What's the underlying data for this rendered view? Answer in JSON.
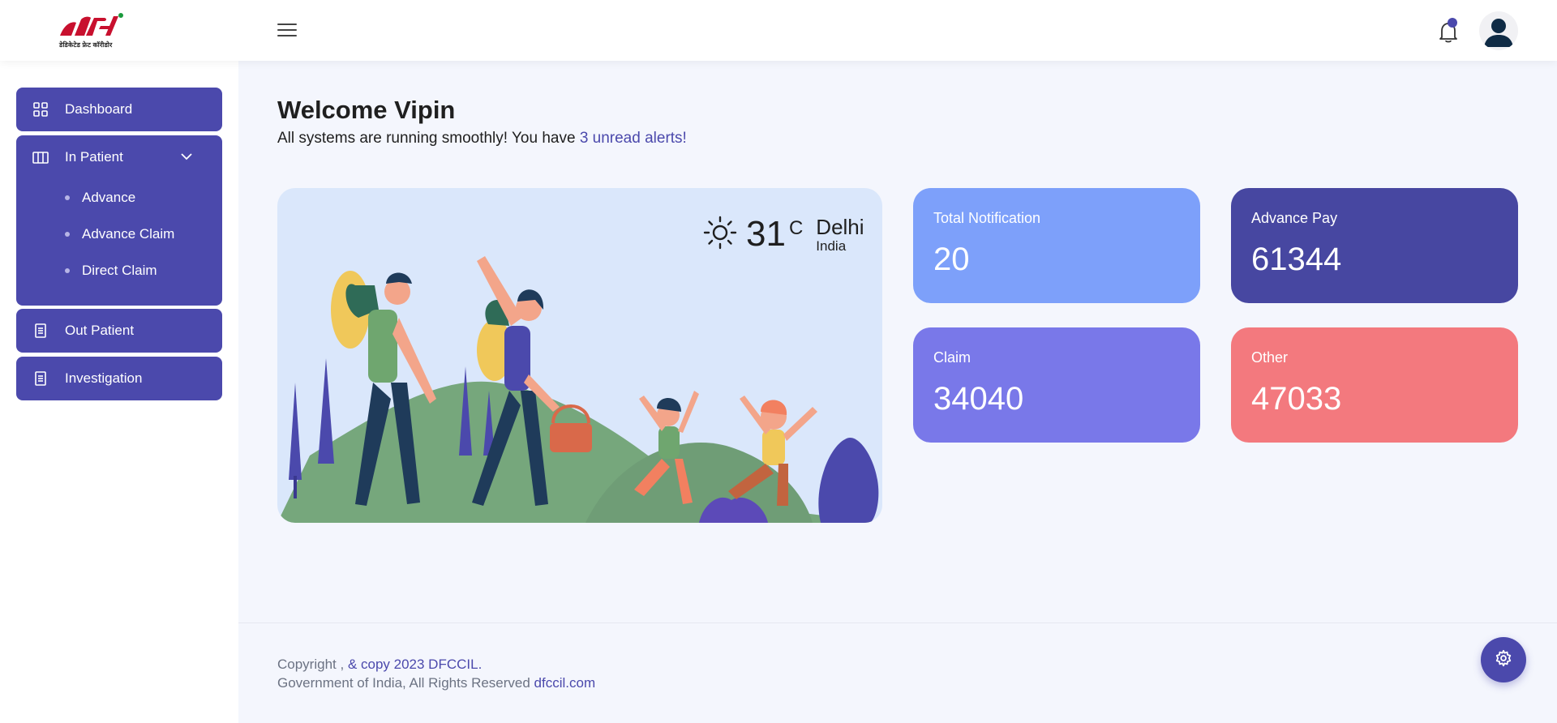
{
  "header": {
    "logo_text": "dfc",
    "logo_subtitle": "डेडिकेटेड फ्रेट कॉरीडोर",
    "notification_count_dot": true
  },
  "sidebar": {
    "items": [
      {
        "label": "Dashboard",
        "icon": "grid-icon"
      },
      {
        "label": "In Patient",
        "icon": "columns-icon",
        "expanded": true,
        "children": [
          {
            "label": "Advance"
          },
          {
            "label": "Advance Claim"
          },
          {
            "label": "Direct Claim"
          }
        ]
      },
      {
        "label": "Out Patient",
        "icon": "document-icon"
      },
      {
        "label": "Investigation",
        "icon": "document-icon"
      }
    ]
  },
  "main": {
    "welcome": "Welcome Vipin",
    "subline_prefix": "All systems are running smoothly! You have ",
    "subline_alerts": "3 unread alerts!",
    "weather": {
      "temperature": "31",
      "unit": "C",
      "city": "Delhi",
      "country": "India",
      "icon": "sun-icon"
    },
    "cards": [
      {
        "label": "Total Notification",
        "value": "20",
        "color": "#7da0fa"
      },
      {
        "label": "Advance Pay",
        "value": "61344",
        "color": "#4747a1"
      },
      {
        "label": "Claim",
        "value": "34040",
        "color": "#7978e9"
      },
      {
        "label": "Other",
        "value": "47033",
        "color": "#f3797e"
      }
    ]
  },
  "footer": {
    "copy_prefix": "Copyright , ",
    "copy_link": "& copy 2023 DFCCIL.",
    "rights_prefix": "Government of India, All Rights Reserved ",
    "rights_link": "dfccil.com"
  },
  "colors": {
    "primary": "#4b49ac",
    "background": "#f4f6fd",
    "hero_bg": "#dae7fb"
  }
}
